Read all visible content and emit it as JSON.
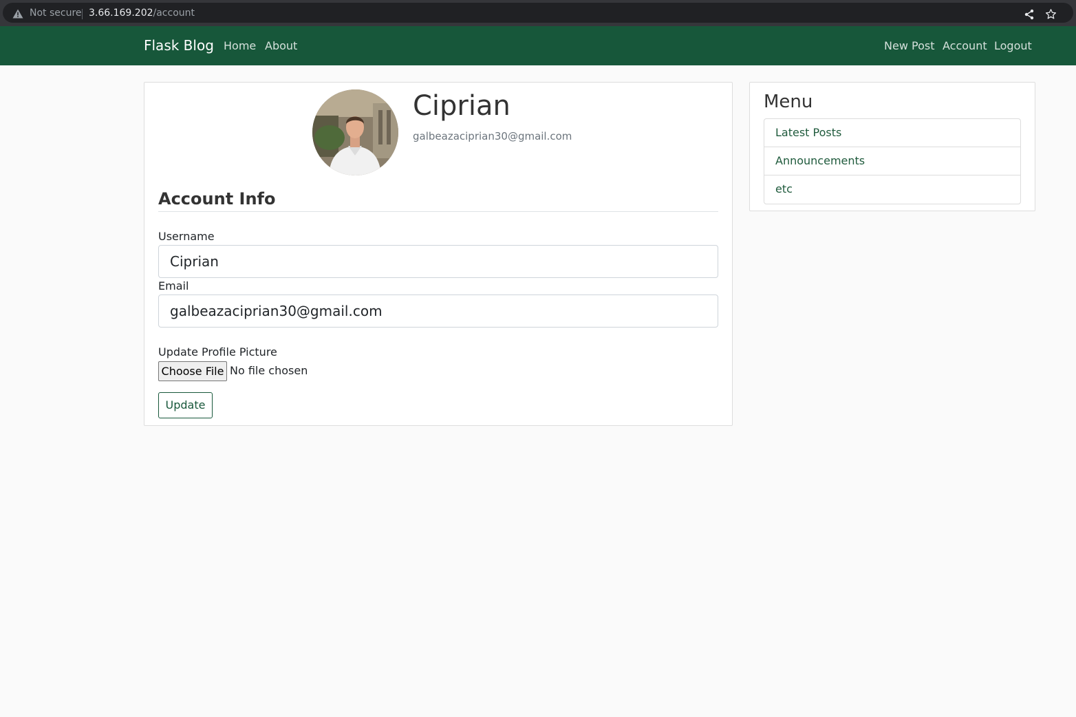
{
  "browser": {
    "security_label": "Not secure",
    "url_host": "3.66.169.202",
    "url_path": "/account"
  },
  "navbar": {
    "brand": "Flask Blog",
    "left_links": [
      "Home",
      "About"
    ],
    "right_links": [
      "New Post",
      "Account",
      "Logout"
    ],
    "background_color": "#17573a"
  },
  "profile": {
    "name": "Ciprian",
    "email": "galbeazaciprian30@gmail.com"
  },
  "form": {
    "legend": "Account Info",
    "username_label": "Username",
    "username_value": "Ciprian",
    "email_label": "Email",
    "email_value": "galbeazaciprian30@gmail.com",
    "picture_label": "Update Profile Picture",
    "choose_file_label": "Choose File",
    "file_status": "No file chosen",
    "submit_label": "Update"
  },
  "sidebar": {
    "title": "Menu",
    "items": [
      "Latest Posts",
      "Announcements",
      "etc"
    ]
  }
}
